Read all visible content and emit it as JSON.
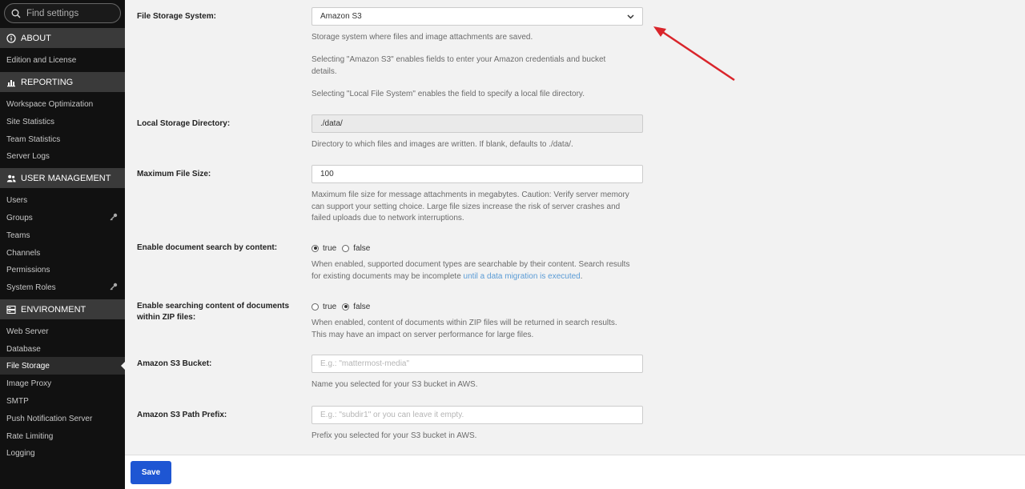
{
  "sidebar": {
    "search_placeholder": "Find settings",
    "sections": [
      {
        "title": "ABOUT",
        "icon": "info-icon",
        "items": [
          {
            "label": "Edition and License"
          }
        ]
      },
      {
        "title": "REPORTING",
        "icon": "bar-chart-icon",
        "items": [
          {
            "label": "Workspace Optimization"
          },
          {
            "label": "Site Statistics"
          },
          {
            "label": "Team Statistics"
          },
          {
            "label": "Server Logs"
          }
        ]
      },
      {
        "title": "USER MANAGEMENT",
        "icon": "users-icon",
        "items": [
          {
            "label": "Users"
          },
          {
            "label": "Groups",
            "badge": "key-icon"
          },
          {
            "label": "Teams"
          },
          {
            "label": "Channels"
          },
          {
            "label": "Permissions"
          },
          {
            "label": "System Roles",
            "badge": "key-icon"
          }
        ]
      },
      {
        "title": "ENVIRONMENT",
        "icon": "server-icon",
        "items": [
          {
            "label": "Web Server"
          },
          {
            "label": "Database"
          },
          {
            "label": "File Storage",
            "active": true
          },
          {
            "label": "Image Proxy"
          },
          {
            "label": "SMTP"
          },
          {
            "label": "Push Notification Server"
          },
          {
            "label": "Rate Limiting"
          },
          {
            "label": "Logging"
          }
        ]
      }
    ]
  },
  "settings": {
    "file_storage": {
      "label": "File Storage System:",
      "value": "Amazon S3",
      "help1": "Storage system where files and image attachments are saved.",
      "help2": "Selecting \"Amazon S3\" enables fields to enter your Amazon credentials and bucket details.",
      "help3": "Selecting \"Local File System\" enables the field to specify a local file directory."
    },
    "local_dir": {
      "label": "Local Storage Directory:",
      "value": "./data/",
      "help": "Directory to which files and images are written. If blank, defaults to ./data/."
    },
    "max_size": {
      "label": "Maximum File Size:",
      "value": "100",
      "help": "Maximum file size for message attachments in megabytes. Caution: Verify server memory can support your setting choice. Large file sizes increase the risk of server crashes and failed uploads due to network interruptions."
    },
    "doc_search": {
      "label": "Enable document search by content:",
      "true_label": "true",
      "false_label": "false",
      "selected": "true",
      "help": "When enabled, supported document types are searchable by their content. Search results for existing documents may be incomplete ",
      "link": "until a data migration is executed",
      "help_end": "."
    },
    "zip_search": {
      "label": "Enable searching content of documents within ZIP files:",
      "true_label": "true",
      "false_label": "false",
      "selected": "false",
      "help": "When enabled, content of documents within ZIP files will be returned in search results. This may have an impact on server performance for large files."
    },
    "s3_bucket": {
      "label": "Amazon S3 Bucket:",
      "placeholder": "E.g.: \"mattermost-media\"",
      "help": "Name you selected for your S3 bucket in AWS."
    },
    "s3_prefix": {
      "label": "Amazon S3 Path Prefix:",
      "placeholder": "E.g.: \"subdir1\" or you can leave it empty.",
      "help": "Prefix you selected for your S3 bucket in AWS."
    }
  },
  "footer": {
    "save_label": "Save"
  },
  "colors": {
    "accent": "#1e56d3",
    "annotation_arrow": "#d9252b",
    "link": "#5a9bd5"
  }
}
